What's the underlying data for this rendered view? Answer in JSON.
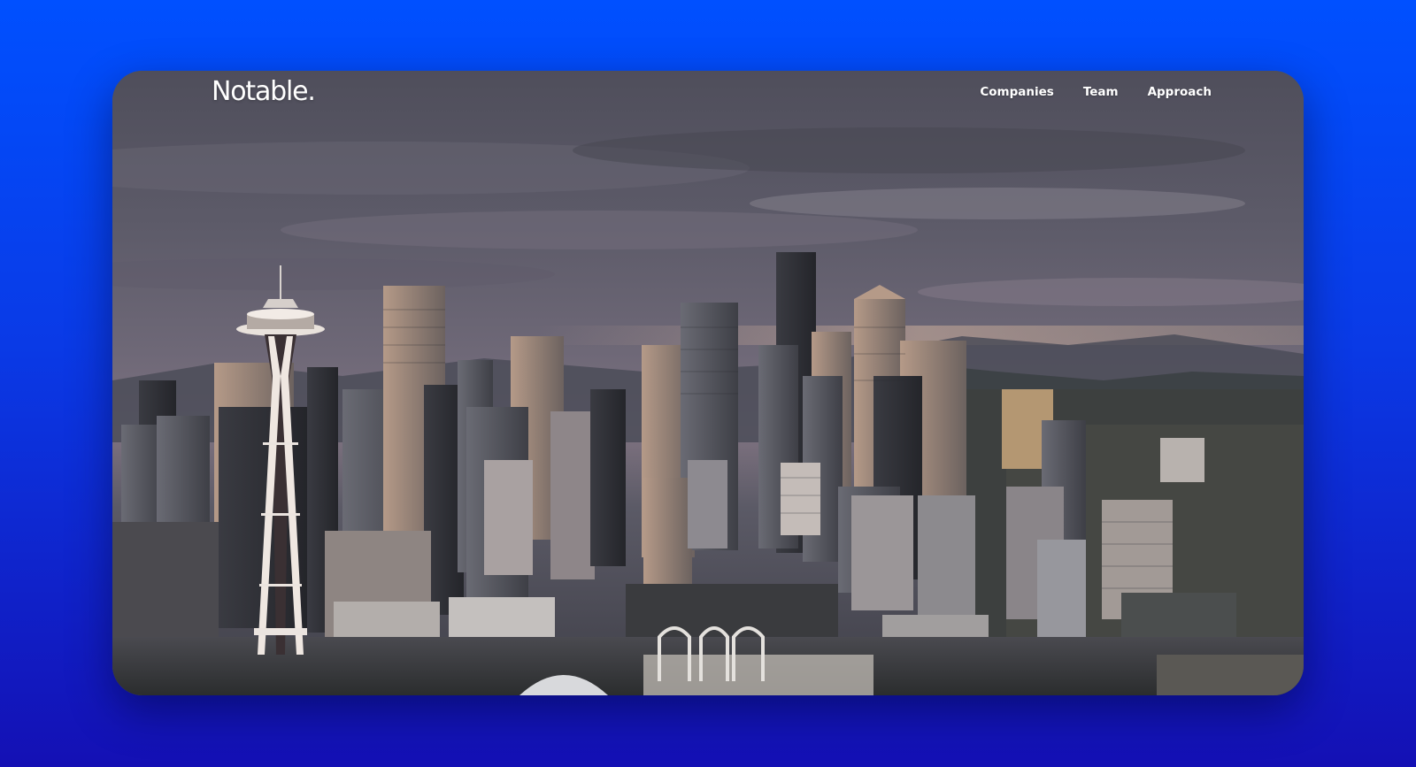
{
  "brand": {
    "logo_text": "Notable."
  },
  "nav": {
    "items": [
      {
        "label": "Companies"
      },
      {
        "label": "Team"
      },
      {
        "label": "Approach"
      }
    ]
  },
  "hero": {
    "image_subject": "city-skyline-video-frame"
  },
  "colors": {
    "background_top": "#0050ff",
    "background_bottom": "#1410b4",
    "nav_text": "#ffffff"
  }
}
